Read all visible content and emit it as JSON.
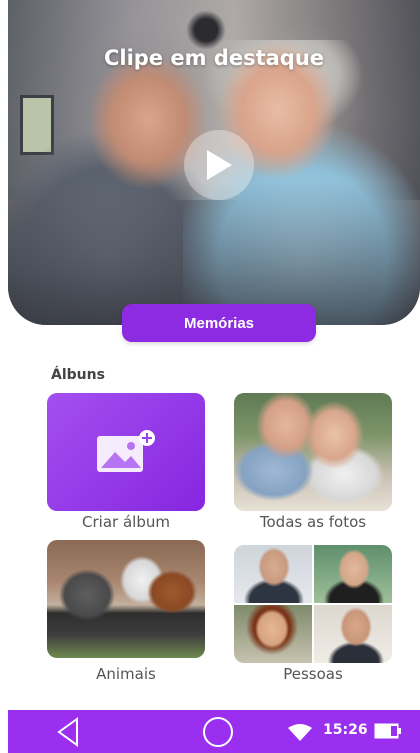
{
  "hero": {
    "title": "Clipe em destaque",
    "play_icon": "play-icon",
    "button_label": "Memórias"
  },
  "albums": {
    "section_title": "Álbuns",
    "items": [
      {
        "label": "Criar álbum",
        "icon": "add-image-icon"
      },
      {
        "label": "Todas as fotos"
      },
      {
        "label": "Animais"
      },
      {
        "label": "Pessoas"
      }
    ]
  },
  "nav": {
    "back_icon": "back-triangle-icon",
    "home_icon": "home-circle-icon",
    "wifi_icon": "wifi-icon",
    "time": "15:26",
    "battery_icon": "battery-icon",
    "color": "#9b2ff0"
  },
  "colors": {
    "accent": "#8d2be2",
    "tile_gradient_start": "#a44ff0",
    "tile_gradient_end": "#8626e0"
  }
}
